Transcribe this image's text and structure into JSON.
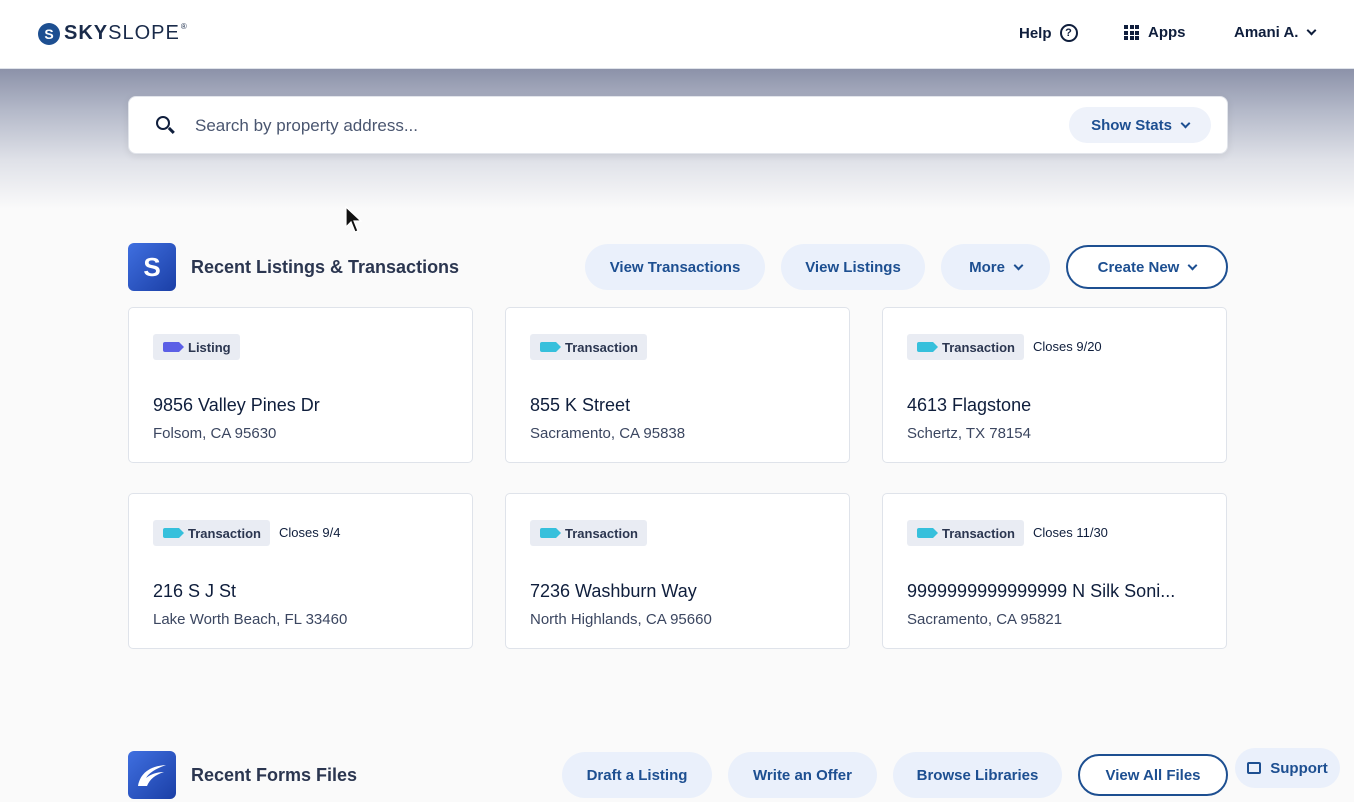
{
  "header": {
    "logo_text_bold": "SKY",
    "logo_text_light": "SLOPE",
    "logo_mark": "S",
    "help_label": "Help",
    "apps_label": "Apps",
    "user_name": "Amani A."
  },
  "search": {
    "placeholder": "Search by property address...",
    "stats_label": "Show Stats"
  },
  "listings_section": {
    "title": "Recent Listings & Transactions",
    "actions": {
      "view_transactions": "View Transactions",
      "view_listings": "View Listings",
      "more": "More",
      "create_new": "Create New"
    },
    "cards": [
      {
        "type": "Listing",
        "closes": "",
        "address": "9856 Valley Pines Dr",
        "city": "Folsom, CA 95630"
      },
      {
        "type": "Transaction",
        "closes": "",
        "address": "855 K Street",
        "city": "Sacramento, CA 95838"
      },
      {
        "type": "Transaction",
        "closes": "Closes 9/20",
        "address": "4613 Flagstone",
        "city": "Schertz, TX 78154"
      },
      {
        "type": "Transaction",
        "closes": "Closes 9/4",
        "address": "216 S J St",
        "city": "Lake Worth Beach, FL 33460"
      },
      {
        "type": "Transaction",
        "closes": "",
        "address": "7236 Washburn Way",
        "city": "North Highlands, CA 95660"
      },
      {
        "type": "Transaction",
        "closes": "Closes 11/30",
        "address": "9999999999999999 N Silk Soni...",
        "city": "Sacramento, CA 95821"
      }
    ]
  },
  "forms_section": {
    "title": "Recent Forms Files",
    "actions": {
      "draft_listing": "Draft a Listing",
      "write_offer": "Write an Offer",
      "browse_libraries": "Browse Libraries",
      "view_all_files": "View All Files"
    }
  },
  "support_label": "Support",
  "colors": {
    "brand": "#1d4f91",
    "listing_tag": "#5b5fe6",
    "transaction_tag": "#36c0dc"
  }
}
